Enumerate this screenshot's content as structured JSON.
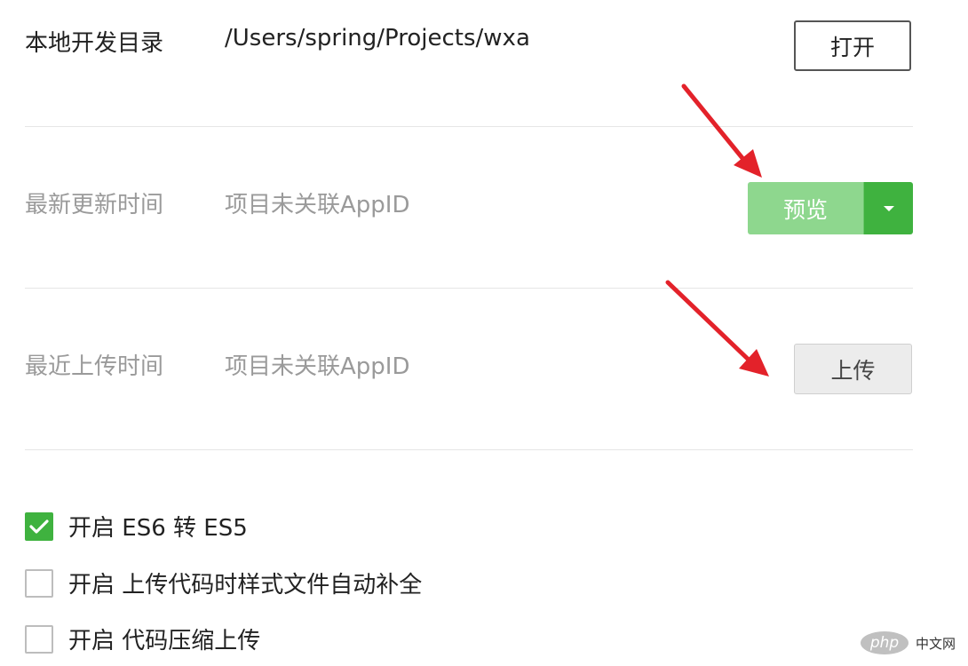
{
  "dev_dir": {
    "label": "本地开发目录",
    "path": "/Users/spring/Projects/wxa",
    "open_label": "打开"
  },
  "last_update": {
    "label": "最新更新时间",
    "value": "项目未关联AppID",
    "preview_label": "预览"
  },
  "last_upload": {
    "label": "最近上传时间",
    "value": "项目未关联AppID",
    "upload_label": "上传"
  },
  "options": [
    {
      "label": "开启 ES6 转 ES5",
      "checked": true
    },
    {
      "label": "开启 上传代码时样式文件自动补全",
      "checked": false
    },
    {
      "label": "开启 代码压缩上传",
      "checked": false
    }
  ],
  "watermark": {
    "logo_text": "php",
    "text": "中文网"
  },
  "colors": {
    "accent_green": "#3fb23f",
    "preview_green": "#8ed78e",
    "arrow_red": "#e3222a"
  }
}
